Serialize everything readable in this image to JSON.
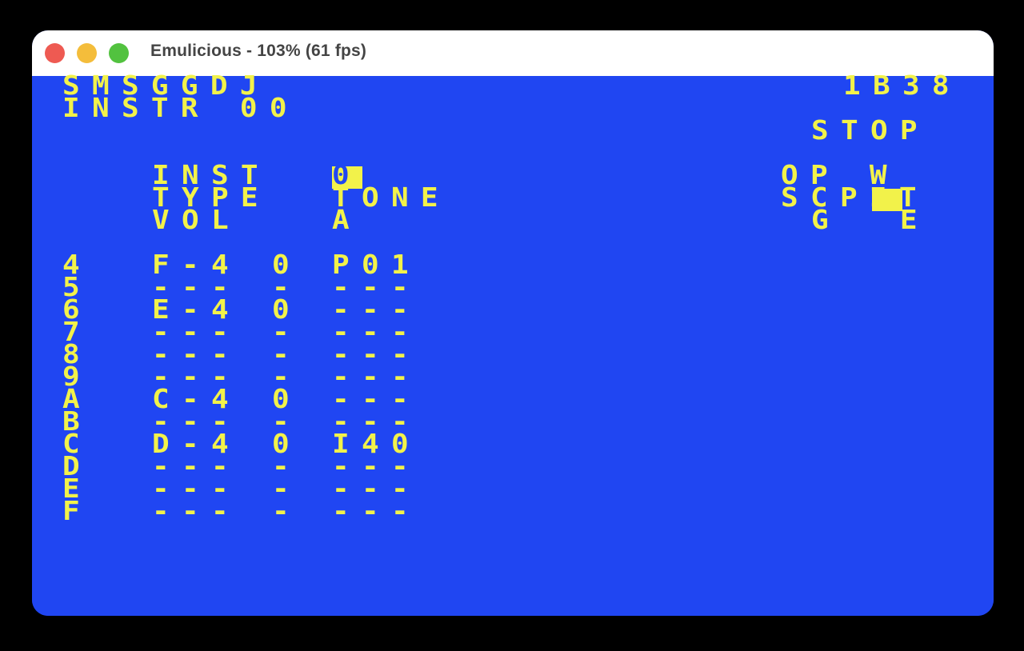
{
  "window": {
    "title": "Emulicious - 103% (61 fps)"
  },
  "header": {
    "app_name": "SMSGGDJ",
    "instrument_line": "INSTR 00",
    "address": "1B38",
    "status": "STOP"
  },
  "instrument_panel": {
    "labels": [
      "INST",
      "TYPE",
      "VOL"
    ],
    "values": [
      "0",
      "TONE",
      "A"
    ]
  },
  "op_panel": {
    "line1": "OP W",
    "line2": "SCPIT",
    "line3": "G  E"
  },
  "pattern": {
    "row_index_column": [
      "4",
      "5",
      "6",
      "7",
      "8",
      "9",
      "A",
      "B",
      "C",
      "D",
      "E",
      "F"
    ],
    "rows": [
      {
        "note": "F-4",
        "instrument": "0",
        "effect": "P01"
      },
      {
        "note": "---",
        "instrument": "-",
        "effect": "---"
      },
      {
        "note": "E-4",
        "instrument": "0",
        "effect": "---"
      },
      {
        "note": "---",
        "instrument": "-",
        "effect": "---"
      },
      {
        "note": "---",
        "instrument": "-",
        "effect": "---"
      },
      {
        "note": "---",
        "instrument": "-",
        "effect": "---"
      },
      {
        "note": "C-4",
        "instrument": "0",
        "effect": "---"
      },
      {
        "note": "---",
        "instrument": "-",
        "effect": "---"
      },
      {
        "note": "D-4",
        "instrument": "0",
        "effect": "I40"
      },
      {
        "note": "---",
        "instrument": "-",
        "effect": "---"
      },
      {
        "note": "---",
        "instrument": "-",
        "effect": "---"
      },
      {
        "note": "---",
        "instrument": "-",
        "effect": "---"
      }
    ]
  },
  "colors": {
    "background": "#2046f2",
    "text": "#f2f24a",
    "titlebar": "#ffffff",
    "close": "#ee5a52",
    "minimize": "#f4bd3b",
    "maximize": "#52c23f"
  }
}
